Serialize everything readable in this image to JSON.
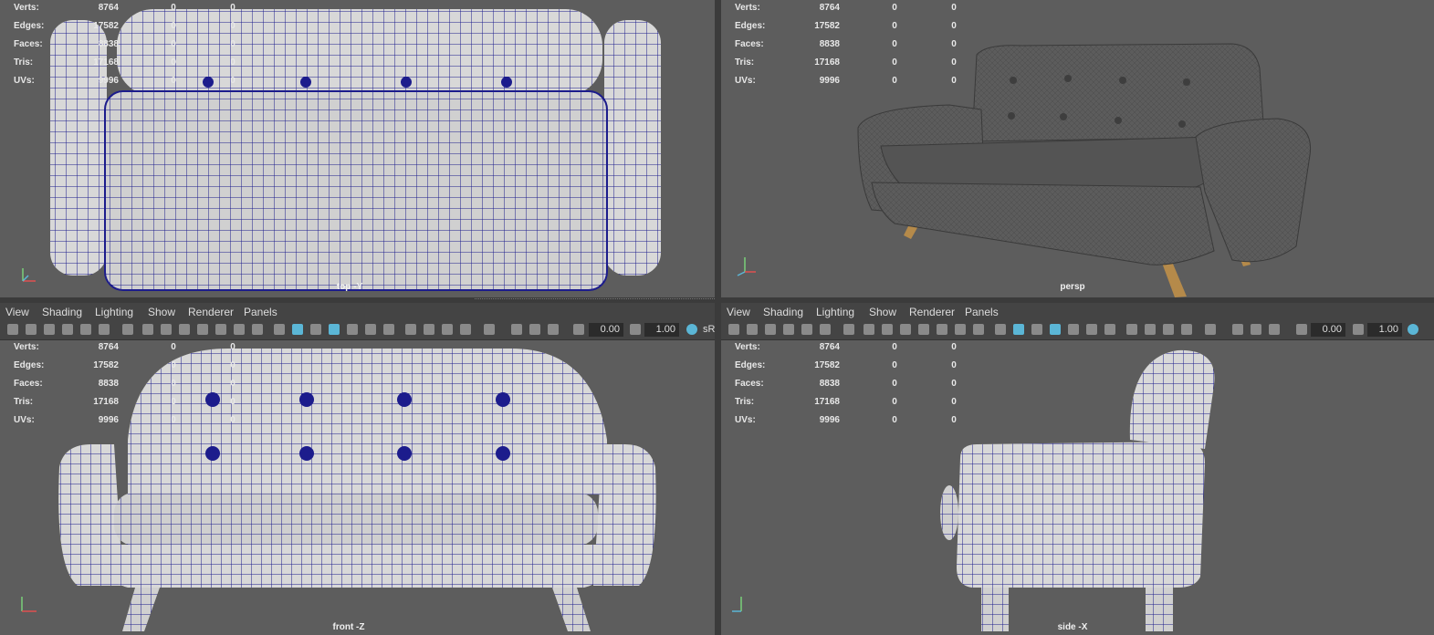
{
  "stats": {
    "labels": [
      "Verts:",
      "Edges:",
      "Faces:",
      "Tris:",
      "UVs:"
    ],
    "values": [
      "8764",
      "17582",
      "8838",
      "17168",
      "9996"
    ],
    "zeros": [
      "0",
      "0"
    ]
  },
  "viewports": {
    "top": {
      "label": "top -Y"
    },
    "persp": {
      "label": "persp"
    },
    "front": {
      "label": "front -Z"
    },
    "side": {
      "label": "side -X"
    }
  },
  "menu": {
    "view": "View",
    "shading": "Shading",
    "lighting": "Lighting",
    "show": "Show",
    "renderer": "Renderer",
    "panels": "Panels"
  },
  "toolbar": {
    "exposure": "0.00",
    "gamma": "1.00",
    "color_mgmt": "sR"
  },
  "colors": {
    "viewport_bg": "#5d5d5d",
    "wire": "#1c1c8c",
    "mesh_fill": "#d8d8d8",
    "persp_fabric": "#5a5a5a",
    "leg_wood": "#b58a4a",
    "accent": "#5bb6d6"
  }
}
